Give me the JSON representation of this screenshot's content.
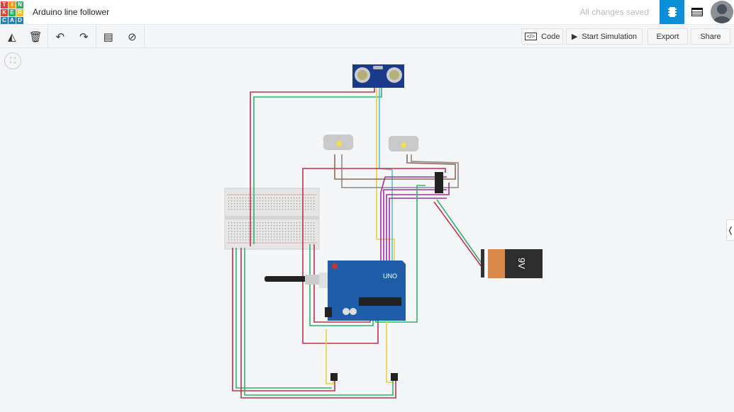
{
  "logo": {
    "letters": [
      "T",
      "I",
      "N",
      "K",
      "E",
      "R",
      "C",
      "A",
      "D"
    ],
    "colors": [
      "#e73d2b",
      "#f39c12",
      "#27ae60",
      "#e73d2b",
      "#27ae60",
      "#f1c40f",
      "#2980b9",
      "#2980b9",
      "#2980b9"
    ]
  },
  "header": {
    "title": "Arduino line follower",
    "status": "All changes saved",
    "accent": "#0a8fd8"
  },
  "toolbar": {
    "code_label": "Code",
    "simulate_label": "Start Simulation",
    "export_label": "Export",
    "share_label": "Share"
  },
  "components": {
    "battery_label": "9V",
    "arduino_label": "UNO"
  }
}
